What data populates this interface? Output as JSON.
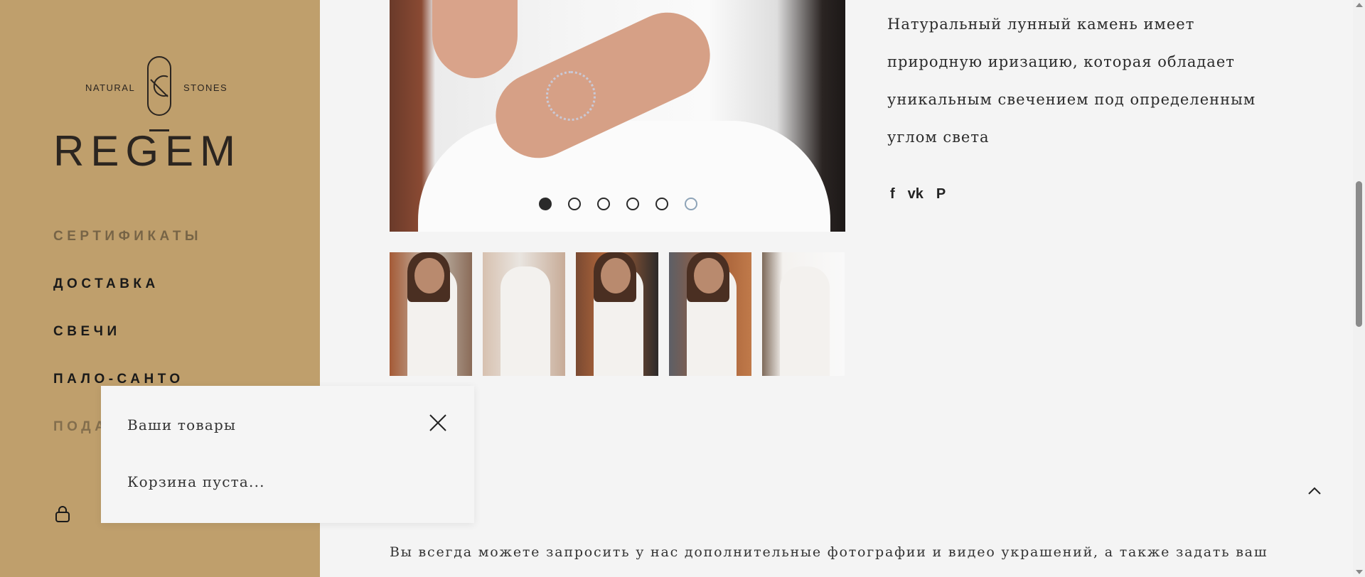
{
  "brand": {
    "top_left": "NATURAL",
    "top_right": "STONES",
    "name": "REGEM"
  },
  "sidebar": {
    "items": [
      {
        "label": "СЕРТИФИКАТЫ"
      },
      {
        "label": "ДОСТАВКА"
      },
      {
        "label": "СВЕЧИ"
      },
      {
        "label": "ПАЛО-САНТО"
      },
      {
        "label": "ПОДАРОЧНЫЕ"
      }
    ]
  },
  "carousel": {
    "slide_count": 6,
    "active_index": 0
  },
  "description": {
    "text": "Натуральный лунный камень имеет природную иризацию, которая обладает уникальным свечением под определенным углом света"
  },
  "social": {
    "facebook": "f",
    "vk": "vk",
    "pinterest": "P"
  },
  "footer_text": "Вы всегда можете запросить у нас дополнительные фотографии и видео украшений, а также задать ваш",
  "cart": {
    "title": "Ваши товары",
    "empty_message": "Корзина пуста..."
  },
  "colors": {
    "sidebar_bg": "#bf9f6c",
    "page_bg": "#f4f4f4",
    "text_dark": "#1a1a1a"
  }
}
